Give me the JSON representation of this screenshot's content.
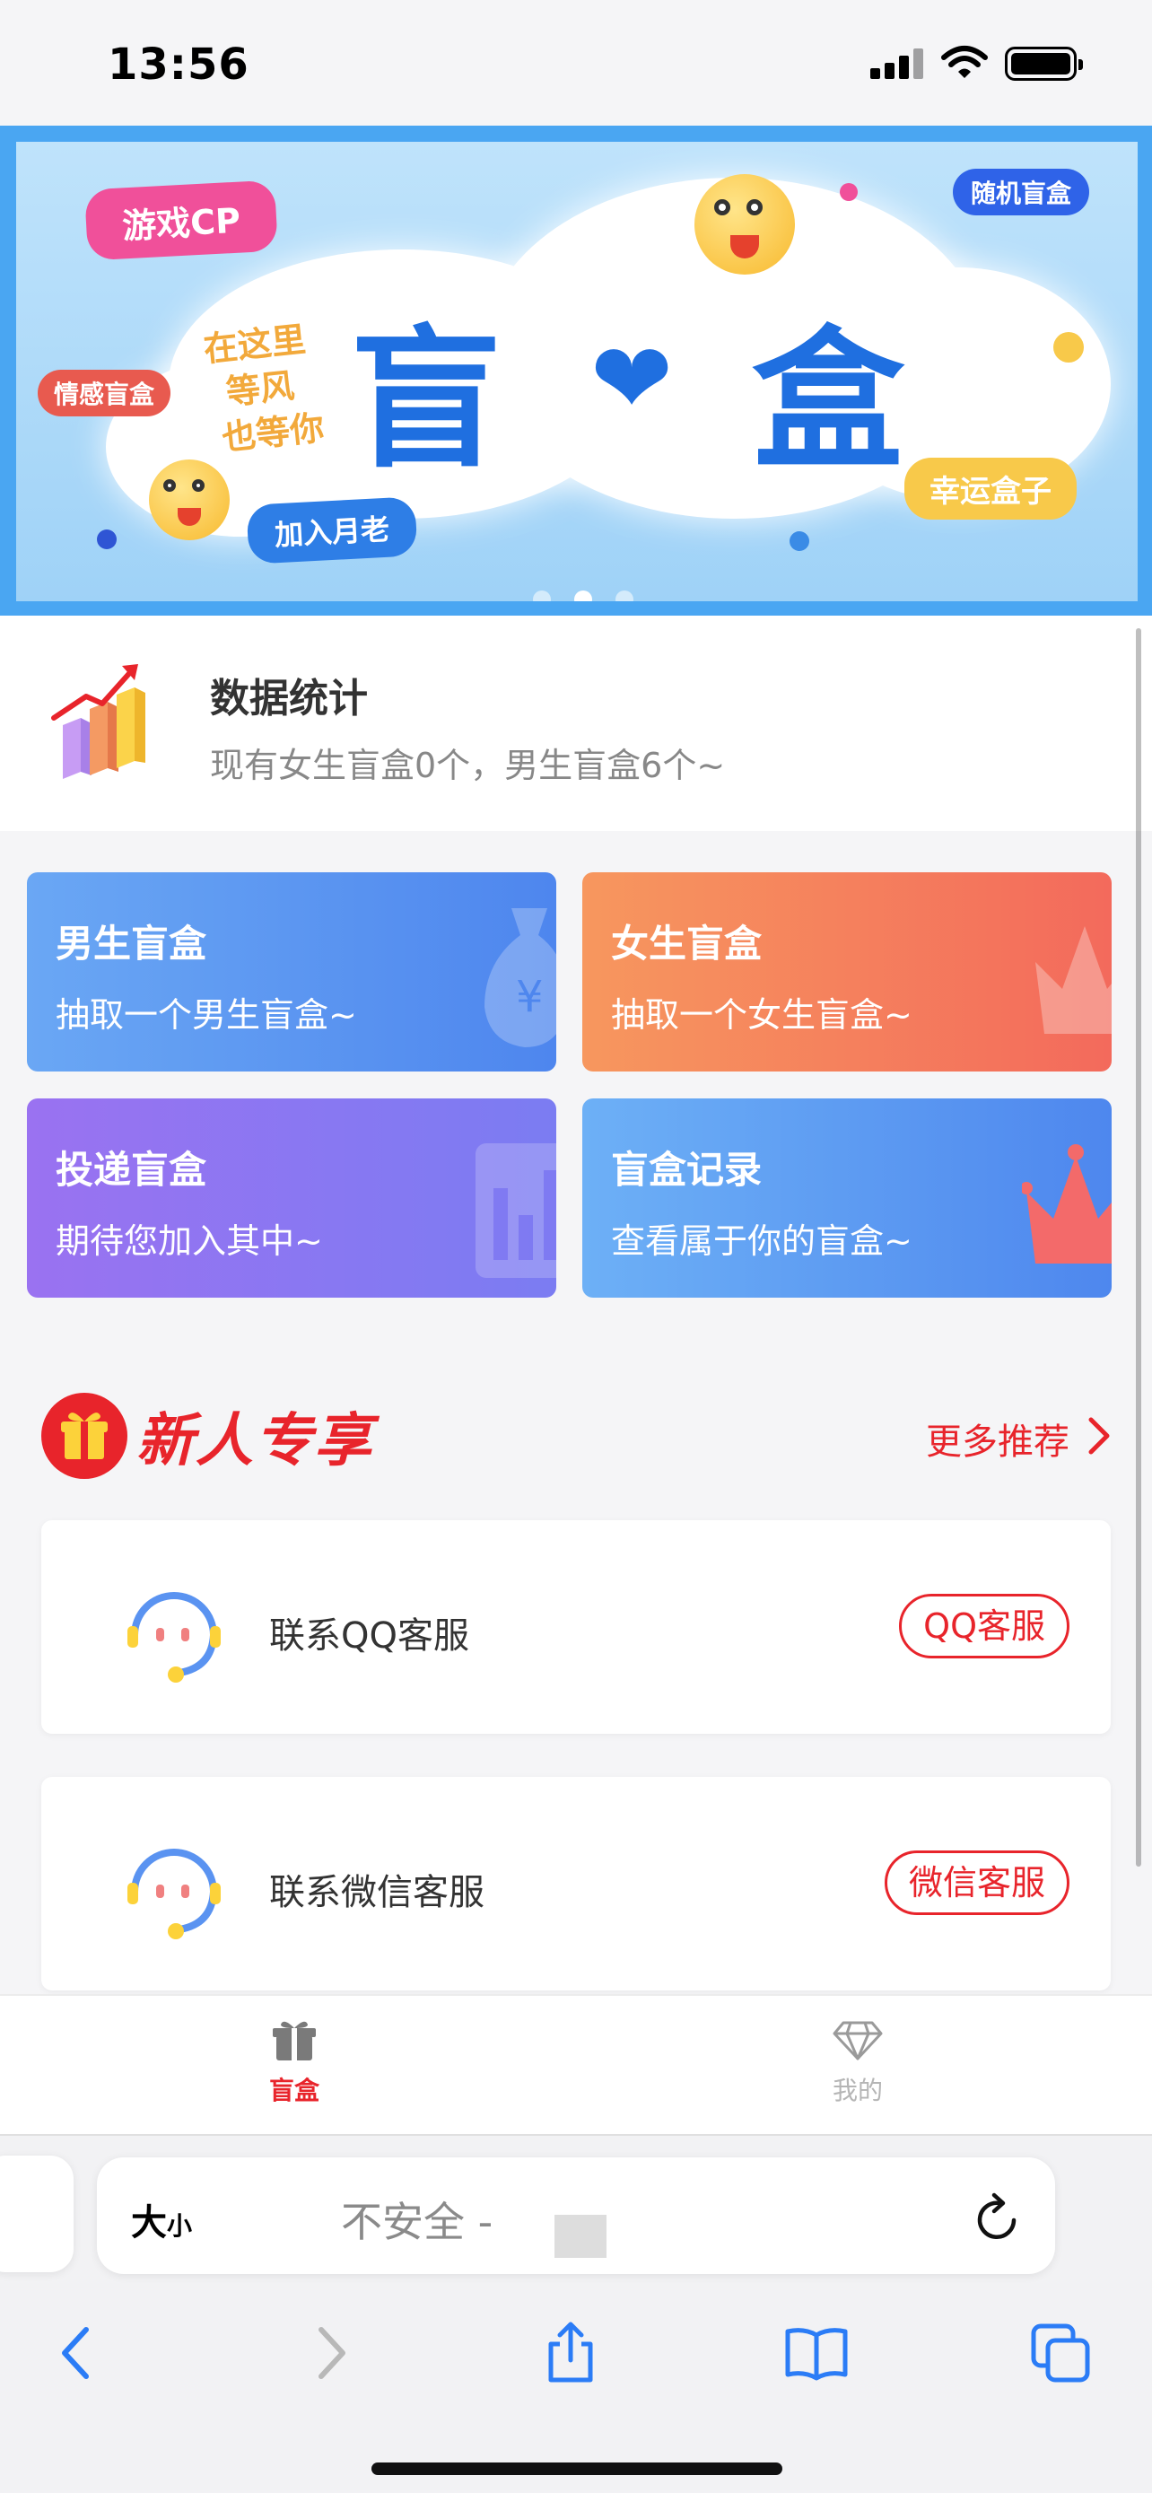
{
  "status_bar": {
    "time": "13:56"
  },
  "banner": {
    "title_left": "盲",
    "title_right": "盒",
    "tags": {
      "game_cp": "游戏CP",
      "emotion_box": "情感盲盒",
      "random_box": "随机盲盒",
      "join": "加入月老",
      "lucky_box": "幸运盒子"
    },
    "handwriting": [
      "在这里",
      "等风",
      "也等你"
    ],
    "page_count": 3,
    "active_page": 1
  },
  "stats": {
    "title": "数据统计",
    "subtitle": "现有女生盲盒0个，男生盲盒6个~"
  },
  "grid": {
    "boy": {
      "title": "男生盲盒",
      "subtitle": "抽取一个男生盲盒~"
    },
    "girl": {
      "title": "女生盲盒",
      "subtitle": "抽取一个女生盲盒~"
    },
    "post": {
      "title": "投递盲盒",
      "subtitle": "期待您加入其中~"
    },
    "records": {
      "title": "盲盒记录",
      "subtitle": "查看属于你的盲盒~"
    }
  },
  "section": {
    "title": "新人专享",
    "more": "更多推荐"
  },
  "services": [
    {
      "label": "联系QQ客服",
      "button": "QQ客服"
    },
    {
      "label": "联系微信客服",
      "button": "微信客服"
    }
  ],
  "tabbar": {
    "box": "盲盒",
    "me": "我的"
  },
  "browser": {
    "text_size_big": "大",
    "text_size_small": "小",
    "url_text": "不安全 -"
  },
  "colors": {
    "accent_red": "#e8242b",
    "boy_card": "#5a93f1",
    "girl_card": "#f4805d",
    "post_card": "#8a77f2",
    "records_card": "#5e9cf2",
    "banner_border": "#4aa6f2"
  }
}
